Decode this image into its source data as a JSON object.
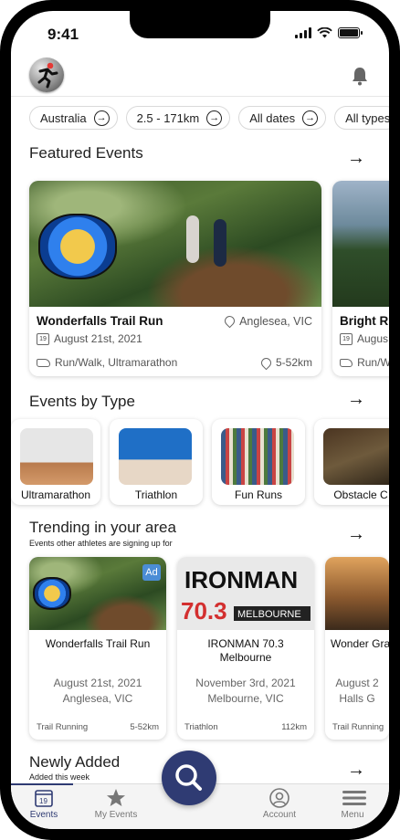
{
  "status": {
    "time": "9:41"
  },
  "header": {
    "logo": "runner-logo",
    "notifications_icon": "bell-icon"
  },
  "filters": [
    {
      "label": "Australia"
    },
    {
      "label": "2.5 - 171km"
    },
    {
      "label": "All dates"
    },
    {
      "label": "All types"
    }
  ],
  "featured": {
    "title": "Featured Events",
    "cards": [
      {
        "name": "Wonderfalls Trail Run",
        "location": "Anglesea, VIC",
        "date": "August 21st, 2021",
        "types": "Run/Walk, Ultramarathon",
        "distance": "5-52km"
      },
      {
        "name": "Bright R",
        "date": "Augus",
        "types": "Run/Wa"
      }
    ]
  },
  "types": {
    "title": "Events by Type",
    "items": [
      {
        "label": "Ultramarathon"
      },
      {
        "label": "Triathlon"
      },
      {
        "label": "Fun Runs"
      },
      {
        "label": "Obstacle C"
      }
    ]
  },
  "trending": {
    "title": "Trending in your area",
    "subtitle": "Events other athletes are signing up for",
    "cards": [
      {
        "name": "Wonderfalls Trail Run",
        "date": "August 21st, 2021",
        "location": "Anglesea, VIC",
        "category": "Trail Running",
        "distance": "5-52km",
        "ad": "Ad"
      },
      {
        "name": "IRONMAN 70.3 Melbourne",
        "date": "November 3rd, 2021",
        "location": "Melbourne, VIC",
        "category": "Triathlon",
        "distance": "112km"
      },
      {
        "name": "Wonder Gran",
        "date": "August 2",
        "location": "Halls G",
        "category": "Trail Running"
      }
    ]
  },
  "newly": {
    "title": "Newly Added",
    "subtitle": "Added this week"
  },
  "tabs": {
    "events": "Events",
    "my_events": "My Events",
    "account": "Account",
    "menu": "Menu",
    "calendar_day": "19"
  },
  "colors": {
    "accent": "#2f3b73",
    "ad_badge": "#4b8dd6"
  }
}
